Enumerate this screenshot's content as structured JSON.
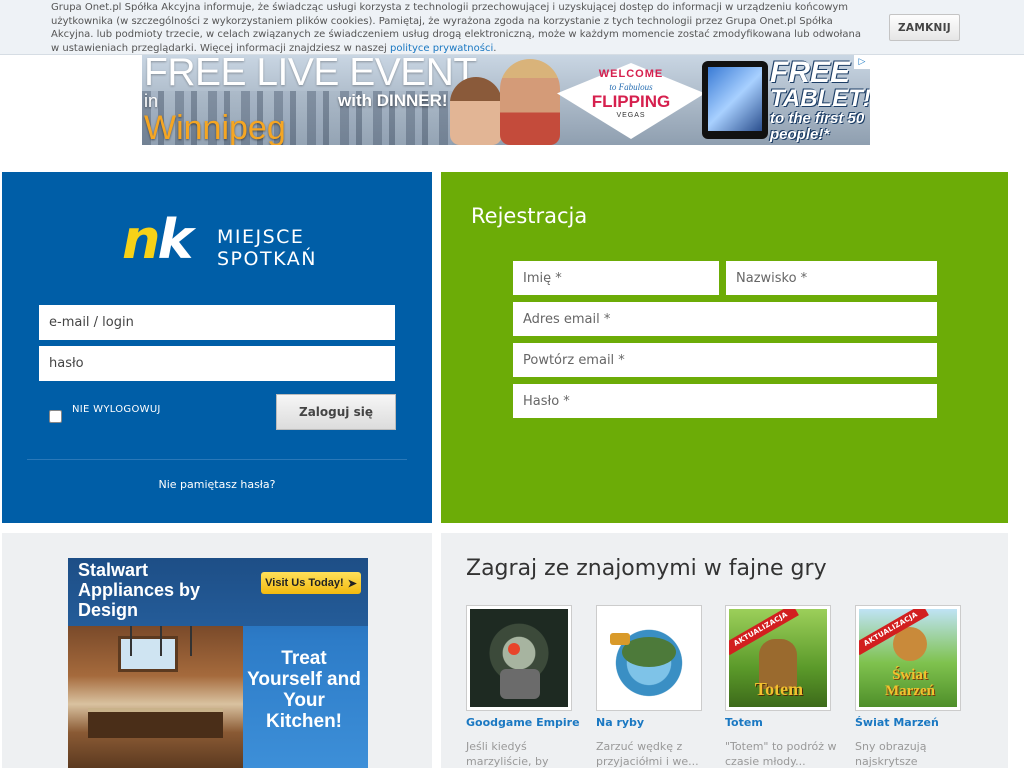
{
  "cookie": {
    "text": "Grupa Onet.pl Spółka Akcyjna informuje, że świadcząc usługi korzysta z technologii przechowującej i uzyskującej dostęp do informacji w urządzeniu końcowym użytkownika (w szczególności z wykorzystaniem plików cookies). Pamiętaj, że wyrażona zgoda na korzystanie z tych technologii przez Grupa Onet.pl Spółka Akcyjna. lub podmioty trzecie, w celach związanych ze świadczeniem usług drogą elektroniczną, może w każdym momencie zostać zmodyfikowana lub odwołana w ustawieniach przeglądarki. Więcej informacji znajdziesz w naszej",
    "link": "polityce prywatności",
    "suffix": ".",
    "close_label": "ZAMKNIJ"
  },
  "top_ad": {
    "line1": "FREE LIVE EVENT",
    "line2": "in",
    "line3": "with DINNER!",
    "line4": "Winnipeg",
    "welcome": "WELCOME",
    "fabulous": "to Fabulous",
    "flipping": "FLIPPING",
    "vegas": "VEGAS",
    "free": "FREE",
    "tablet": "TABLET!",
    "first": "to the first 50 people!*"
  },
  "login": {
    "logo_n": "n",
    "logo_k": "k",
    "logo_tag_line1": "MIEJSCE",
    "logo_tag_line2": "SPOTKAŃ",
    "login_placeholder": "e-mail / login",
    "password_placeholder": "hasło",
    "remember_label": "NIE WYLOGOWUJ",
    "login_button": "Zaloguj się",
    "forgot_link": "Nie pamiętasz hasła?"
  },
  "registration": {
    "title": "Rejestracja",
    "first_name": "Imię *",
    "last_name": "Nazwisko *",
    "email": "Adres email *",
    "email_repeat": "Powtórz email *",
    "password": "Hasło *"
  },
  "side_ad": {
    "headline": "Stalwart Appliances by Design",
    "visit": "Visit Us Today!",
    "treat": "Treat Yourself and Your Kitchen!"
  },
  "games": {
    "title": "Zagraj ze znajomymi w fajne gry",
    "badge": "AKTUALIZACJA",
    "items": [
      {
        "name": "Goodgame Empire",
        "desc": "Jeśli kiedyś marzyliście, by"
      },
      {
        "name": "Na ryby",
        "desc": "Zarzuć wędkę z przyjaciółmi i we..."
      },
      {
        "name": "Totem",
        "desc": "\"Totem\" to podróż w czasie młody..."
      },
      {
        "name": "Świat Marzeń",
        "desc": "Sny obrazują najskrytsze"
      }
    ],
    "art_labels": {
      "totem": "Totem",
      "swiat": "Świat Marzeń"
    }
  },
  "colors": {
    "login_blue": "#005ea7",
    "register_green": "#6cac07",
    "link_blue": "#1a78c2",
    "logo_yellow": "#f7d117"
  }
}
